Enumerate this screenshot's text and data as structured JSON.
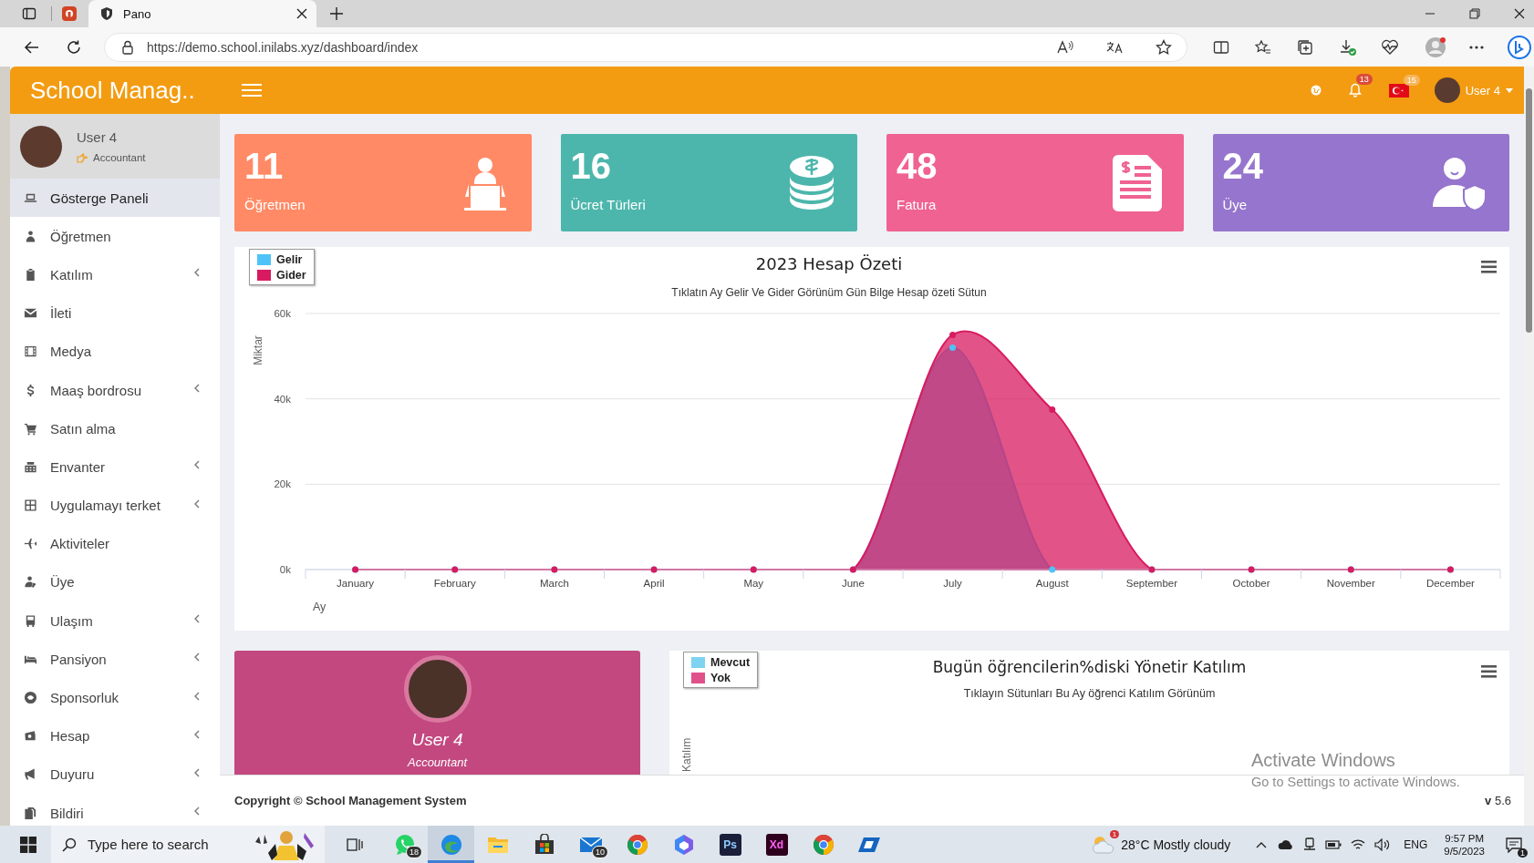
{
  "browser": {
    "tab_title": "Pano",
    "url": "https://demo.school.inilabs.xyz/dashboard/index"
  },
  "header": {
    "brand": "School Manag..",
    "notification_count": "13",
    "flag_count": "15",
    "user": "User 4"
  },
  "sidebar": {
    "user": {
      "name": "User 4",
      "role": "Accountant"
    },
    "items": [
      {
        "label": "Gösterge Paneli",
        "selected": true,
        "expandable": false
      },
      {
        "label": "Öğretmen",
        "selected": false,
        "expandable": false
      },
      {
        "label": "Katılım",
        "selected": false,
        "expandable": true
      },
      {
        "label": "İleti",
        "selected": false,
        "expandable": false
      },
      {
        "label": "Medya",
        "selected": false,
        "expandable": false
      },
      {
        "label": "Maaş bordrosu",
        "selected": false,
        "expandable": true
      },
      {
        "label": "Satın alma",
        "selected": false,
        "expandable": false
      },
      {
        "label": "Envanter",
        "selected": false,
        "expandable": true
      },
      {
        "label": "Uygulamayı terket",
        "selected": false,
        "expandable": true
      },
      {
        "label": "Aktiviteler",
        "selected": false,
        "expandable": false
      },
      {
        "label": "Üye",
        "selected": false,
        "expandable": false
      },
      {
        "label": "Ulaşım",
        "selected": false,
        "expandable": true
      },
      {
        "label": "Pansiyon",
        "selected": false,
        "expandable": true
      },
      {
        "label": "Sponsorluk",
        "selected": false,
        "expandable": true
      },
      {
        "label": "Hesap",
        "selected": false,
        "expandable": true
      },
      {
        "label": "Duyuru",
        "selected": false,
        "expandable": true
      },
      {
        "label": "Bildiri",
        "selected": false,
        "expandable": true
      }
    ]
  },
  "stats": [
    {
      "value": "11",
      "label": "Öğretmen",
      "color": "#ff8a65"
    },
    {
      "value": "16",
      "label": "Ücret Türleri",
      "color": "#4db6ac"
    },
    {
      "value": "48",
      "label": "Fatura",
      "color": "#f06292"
    },
    {
      "value": "24",
      "label": "Üye",
      "color": "#9575cd"
    }
  ],
  "income_chart": {
    "subtitle": "Tıklatın Ay Gelir Ve Gider Görünüm Gün Bilge Hesap özeti Sütun",
    "chart_data": {
      "type": "area",
      "title": "2023 Hesap Özeti",
      "xlabel": "Ay",
      "ylabel": "Miktar",
      "categories": [
        "January",
        "February",
        "March",
        "April",
        "May",
        "June",
        "July",
        "August",
        "September",
        "October",
        "November",
        "December"
      ],
      "series": [
        {
          "name": "Gelir",
          "color": "#4fc3f7",
          "values": [
            0,
            0,
            0,
            0,
            0,
            0,
            52000,
            0,
            0,
            0,
            0,
            0
          ]
        },
        {
          "name": "Gider",
          "color": "#d81b60",
          "values": [
            0,
            0,
            0,
            0,
            0,
            0,
            55000,
            37500,
            0,
            0,
            0,
            0
          ]
        }
      ],
      "legend": "top-left",
      "ylim": [
        0,
        60000
      ],
      "yticks": [
        {
          "value": 0,
          "label": "0k"
        },
        {
          "value": 20000,
          "label": "20k"
        },
        {
          "value": 40000,
          "label": "40k"
        },
        {
          "value": 60000,
          "label": "60k"
        }
      ]
    }
  },
  "profile_card": {
    "name": "User 4",
    "role": "Accountant"
  },
  "attendance_chart": {
    "title": "Bugün öğrencilerin%diski Yönetir Katılım",
    "subtitle": "Tıklayın Sütunları Bu Ay öğrenci Katılım Görünüm",
    "ylabel": "Katılım",
    "legend": [
      {
        "label": "Mevcut",
        "color": "#7dd3f0"
      },
      {
        "label": "Yok",
        "color": "#e0508a"
      }
    ]
  },
  "footer": {
    "copyright": "Copyright © School Management System",
    "version": "**v** 5.6"
  },
  "os_notice": {
    "title": "Activate Windows",
    "text": "Go to Settings to activate Windows."
  },
  "taskbar": {
    "search_placeholder": "Type here to search",
    "apps": [
      {
        "kind": "chat",
        "badge": "18",
        "selected": false
      },
      {
        "kind": "browser",
        "selected": true
      },
      {
        "kind": "folder",
        "selected": false
      },
      {
        "kind": "store",
        "selected": false
      },
      {
        "kind": "mail",
        "badge": "10",
        "selected": false
      },
      {
        "kind": "round",
        "selected": false
      },
      {
        "kind": "prism",
        "selected": false
      },
      {
        "kind": "text",
        "label": "Ps",
        "selected": false
      },
      {
        "kind": "text",
        "label": "Xd",
        "selected": false
      },
      {
        "kind": "round",
        "selected": false
      },
      {
        "kind": "remote",
        "selected": false
      }
    ],
    "weather": {
      "badge": "1",
      "text": "28°C Mostly cloudy"
    },
    "language": "ENG",
    "time": "9:57 PM",
    "date": "9/5/2023",
    "notifications": "1"
  }
}
